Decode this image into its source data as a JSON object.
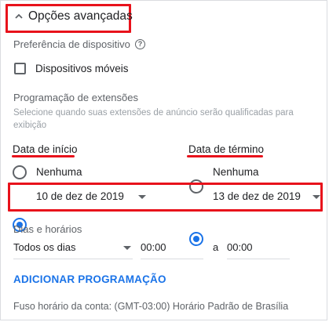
{
  "advanced": {
    "title": "Opções avançadas"
  },
  "device": {
    "label": "Preferência de dispositivo",
    "checkbox_label": "Dispositivos móveis"
  },
  "scheduling": {
    "title": "Programação de extensões",
    "hint": "Selecione quando suas extensões de anúncio serão qualificadas para exibição"
  },
  "start": {
    "title": "Data de início",
    "none_label": "Nenhuma",
    "date_value": "10 de dez de 2019",
    "selected": "date"
  },
  "end": {
    "title": "Data de término",
    "none_label": "Nenhuma",
    "date_value": "13 de dez de 2019",
    "selected": "date"
  },
  "days_hours": {
    "title": "Dias e horários",
    "day_value": "Todos os dias",
    "from_time": "00:00",
    "separator": "a",
    "to_time": "00:00"
  },
  "add_schedule": {
    "label": "ADICIONAR PROGRAMAÇÃO"
  },
  "timezone": {
    "text": "Fuso horário da conta: (GMT-03:00) Horário Padrão de Brasília"
  },
  "colors": {
    "accent": "#1a73e8",
    "highlight": "#e8121b",
    "text": "#202124",
    "muted": "#5f6368"
  }
}
